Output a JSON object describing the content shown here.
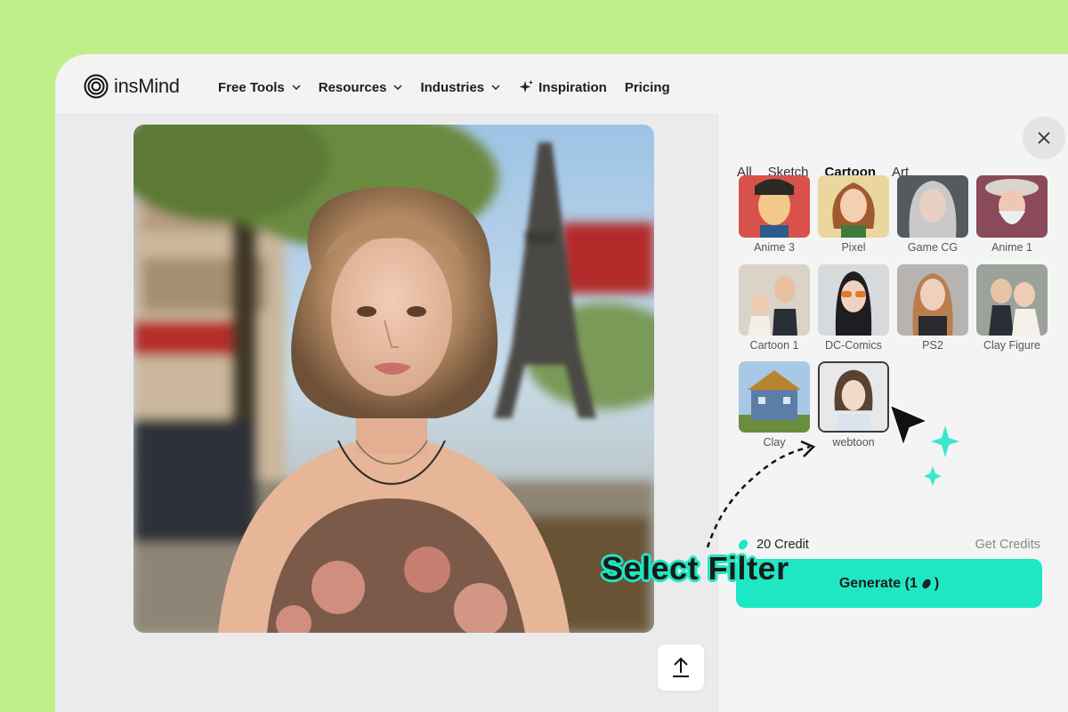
{
  "brand": {
    "name": "insMind"
  },
  "nav": {
    "items": [
      {
        "label": "Free Tools",
        "dropdown": true
      },
      {
        "label": "Resources",
        "dropdown": true
      },
      {
        "label": "Industries",
        "dropdown": true
      },
      {
        "label": "Inspiration",
        "icon": "sparkle-icon"
      },
      {
        "label": "Pricing"
      }
    ]
  },
  "panel": {
    "tabs": [
      "All",
      "Sketch",
      "Cartoon",
      "Art"
    ],
    "active_tab": "Cartoon",
    "filters": [
      {
        "label": "Anime 3"
      },
      {
        "label": "Pixel"
      },
      {
        "label": "Game CG"
      },
      {
        "label": "Anime 1"
      },
      {
        "label": "Cartoon 1"
      },
      {
        "label": "DC-Comics"
      },
      {
        "label": "PS2"
      },
      {
        "label": "Clay Figure"
      },
      {
        "label": "Clay"
      },
      {
        "label": "webtoon",
        "selected": true
      }
    ],
    "credits": "20 Credit",
    "get_credits": "Get Credits",
    "generate_label": "Generate (1",
    "generate_suffix": ")"
  },
  "annotation": {
    "callout": "Select Filter"
  },
  "colors": {
    "background": "#c0ef8a",
    "accent": "#1ee8c4"
  }
}
